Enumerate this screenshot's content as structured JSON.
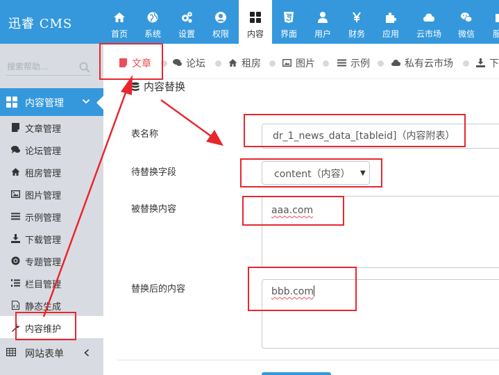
{
  "app": {
    "logo": "迅睿 CMS"
  },
  "topnav": {
    "items": [
      {
        "label": "首页",
        "icon": "home-icon"
      },
      {
        "label": "系统",
        "icon": "globe-icon"
      },
      {
        "label": "设置",
        "icon": "cogs-icon"
      },
      {
        "label": "权限",
        "icon": "user-circle-icon"
      },
      {
        "label": "内容",
        "icon": "grid-icon",
        "active": true
      },
      {
        "label": "界面",
        "icon": "html5-icon"
      },
      {
        "label": "用户",
        "icon": "user-icon"
      },
      {
        "label": "财务",
        "icon": "yen-icon"
      },
      {
        "label": "应用",
        "icon": "puzzle-icon"
      },
      {
        "label": "云市场",
        "icon": "cloud-icon"
      },
      {
        "label": "微信",
        "icon": "wechat-icon"
      },
      {
        "label": "服",
        "icon": "box-icon"
      }
    ]
  },
  "sidebar": {
    "search_placeholder": "搜索帮助...",
    "group": {
      "label": "内容管理",
      "icon": "grid-icon"
    },
    "items": [
      {
        "label": "文章管理",
        "icon": "file-icon"
      },
      {
        "label": "论坛管理",
        "icon": "comments-icon"
      },
      {
        "label": "租房管理",
        "icon": "home-icon"
      },
      {
        "label": "图片管理",
        "icon": "image-icon"
      },
      {
        "label": "示例管理",
        "icon": "list-icon"
      },
      {
        "label": "下载管理",
        "icon": "download-icon"
      },
      {
        "label": "专题管理",
        "icon": "chrome-icon"
      },
      {
        "label": "栏目管理",
        "icon": "list-ol-icon"
      },
      {
        "label": "静态生成",
        "icon": "html-file-icon"
      },
      {
        "label": "内容维护",
        "icon": "wrench-icon",
        "active": true
      }
    ],
    "bottom": {
      "label": "网站表单",
      "icon": "table-icon"
    }
  },
  "tabs": [
    {
      "label": "文章",
      "icon": "file-icon",
      "active": true
    },
    {
      "label": "论坛",
      "icon": "comments-icon"
    },
    {
      "label": "租房",
      "icon": "home-icon"
    },
    {
      "label": "图片",
      "icon": "image-icon"
    },
    {
      "label": "示例",
      "icon": "list-icon"
    },
    {
      "label": "私有云市场",
      "icon": "cloud-icon"
    },
    {
      "label": "下",
      "icon": "download-icon"
    }
  ],
  "panel": {
    "title": "内容替换",
    "table_label": "表名称",
    "table_value": "dr_1_news_data_[tableid]（内容附表）",
    "field_label": "待替换字段",
    "field_value": "content（内容）",
    "search_label": "被替换内容",
    "search_value": "aaa.com",
    "replace_label": "替换后的内容",
    "replace_value": "bbb.com"
  },
  "colors": {
    "primary": "#3598dc",
    "sidebar_bg": "#d8dce2",
    "highlight": "#e8262e",
    "active_tab": "#e7505a"
  }
}
